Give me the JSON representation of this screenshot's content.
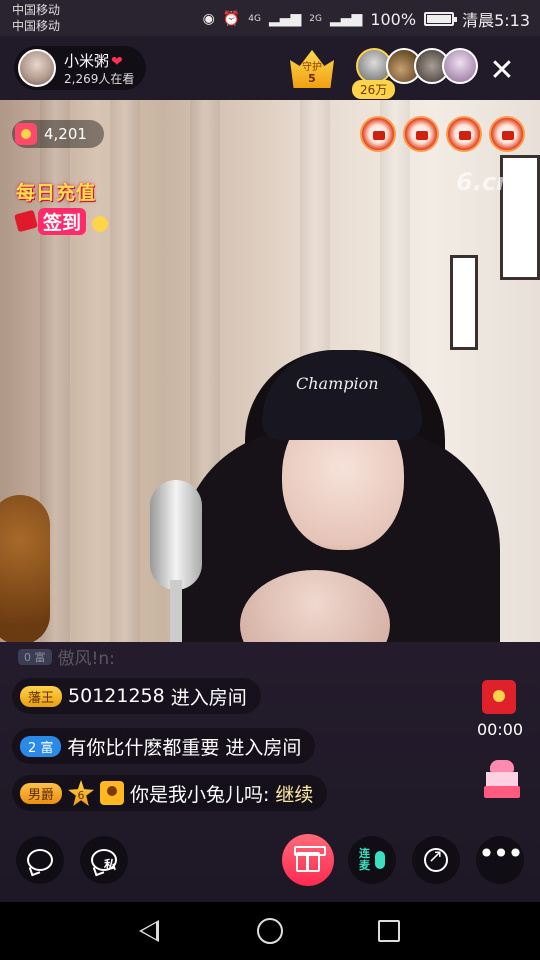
{
  "status_bar": {
    "carrier_1": "中国移动",
    "carrier_2": "中国移动",
    "network_1": "4G",
    "network_2": "2G",
    "battery": "100%",
    "battery_level": 1.0,
    "time": "清晨5:13"
  },
  "header": {
    "host_name": "小米粥",
    "viewer_count": "2,269人在看",
    "guard_label": "守护",
    "guard_count": "5",
    "fan_contribution": "26万"
  },
  "video": {
    "coin_count": "4,201",
    "checkin_line1": "每日充值",
    "checkin_line2": "签到",
    "watermark": "6.cn",
    "cap_text": "Champion"
  },
  "chat": {
    "faded_badge": "0 富",
    "faded_text": "傲风!n: ",
    "messages": [
      {
        "tag": "藩王",
        "user": "50121258",
        "text": "进入房间"
      },
      {
        "tag": "2 富",
        "user": "有你比什麽都重要",
        "text": "进入房间"
      },
      {
        "tag": "男爵",
        "level": "6",
        "user": "你是我小兔儿吗:",
        "text": "继续"
      }
    ]
  },
  "side": {
    "redpacket_timer": "00:00"
  },
  "toolbar": {
    "private_label": "私",
    "linkmic_label": "连麦"
  },
  "colors": {
    "accent": "#ff2a50",
    "gold": "#ffd34a",
    "linkmic": "#3ae0c0",
    "background": "#1a1420"
  }
}
